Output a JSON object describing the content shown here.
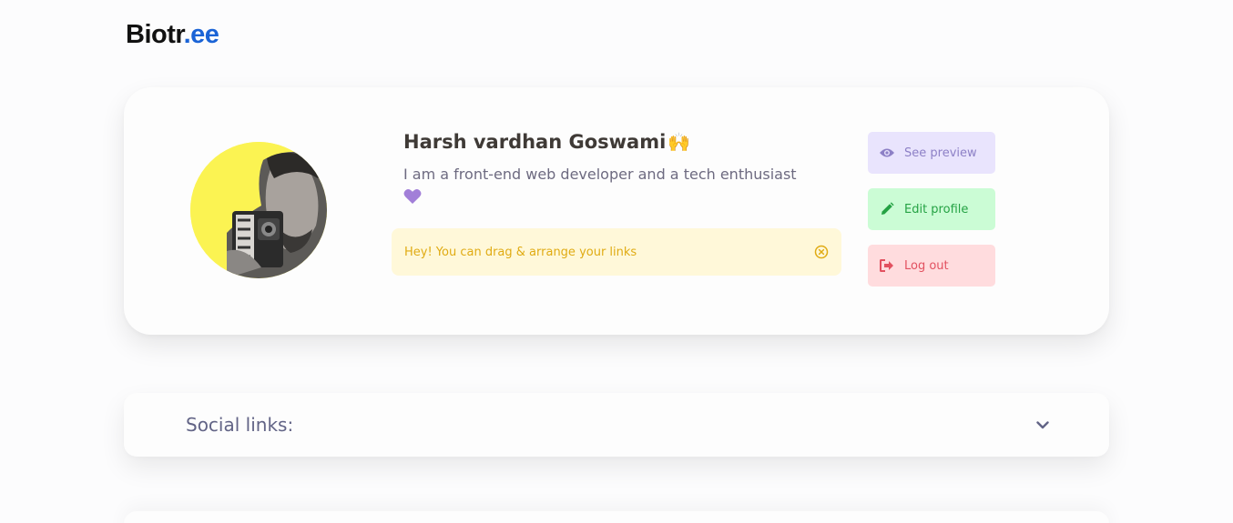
{
  "header": {
    "logo_main": "Biotr",
    "logo_accent": ".ee"
  },
  "profile": {
    "name": "Harsh vardhan Goswami",
    "name_emoji": "🙌",
    "bio": "I am a front-end web developer and a tech enthusiast",
    "bio_emoji": "💜",
    "avatar_alt": "Profile photo"
  },
  "notice": {
    "text": "Hey! You can drag & arrange your links",
    "icon": "close-circle-icon"
  },
  "actions": {
    "preview_label": "See preview",
    "edit_label": "Edit profile",
    "logout_label": "Log out"
  },
  "social": {
    "title": "Social links:"
  },
  "colors": {
    "accent": "#1a63d6",
    "notice_bg": "#fff8d9",
    "notice_text": "#e0ab13",
    "preview_bg": "#e9e4fd",
    "edit_bg": "#cbfcd5",
    "logout_bg": "#ffdcde"
  }
}
